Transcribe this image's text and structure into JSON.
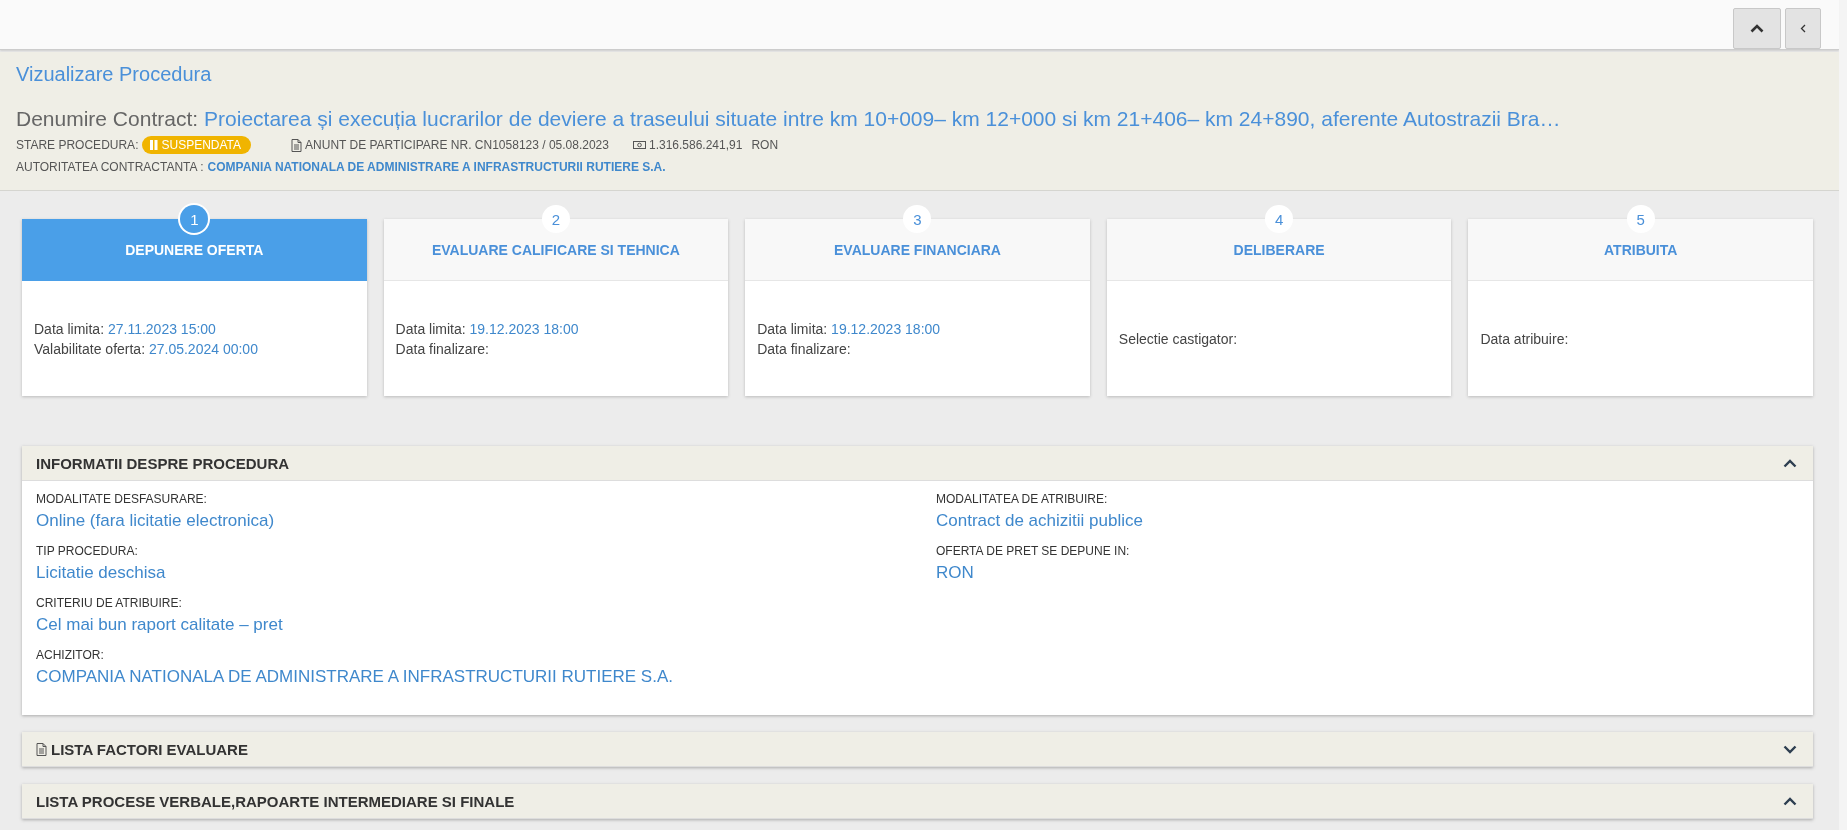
{
  "toolbar": {
    "buttons": [
      {
        "kind": "collapse"
      },
      {
        "kind": "back"
      }
    ]
  },
  "header": {
    "title": "Vizualizare Procedura",
    "contract_label": "Denumire Contract:",
    "contract_name": "Proiectarea și execuția lucrarilor de deviere a traseului situate intre km 10+009– km 12+000 si km 21+406– km 24+890, aferente Autostrazii Bra…",
    "status_label": "STARE PROCEDURA:",
    "status": "SUSPENDATA",
    "notice": "ANUNT DE PARTICIPARE NR. CN1058123 / 05.08.2023",
    "value": "1.316.586.241,91",
    "currency": "RON",
    "authority_label": "AUTORITATEA CONTRACTANTA :",
    "authority": "COMPANIA NATIONALA DE ADMINISTRARE A INFRASTRUCTURII RUTIERE S.A."
  },
  "steps": [
    {
      "number": "1",
      "title": "DEPUNERE OFERTA",
      "selected": true,
      "fields": [
        {
          "label": "Data limita:",
          "value": "27.11.2023 15:00"
        },
        {
          "label": "Valabilitate oferta:",
          "value": "27.05.2024 00:00"
        }
      ]
    },
    {
      "number": "2",
      "title": "EVALUARE CALIFICARE SI TEHNICA",
      "selected": false,
      "fields": [
        {
          "label": "Data limita:",
          "value": "19.12.2023 18:00"
        },
        {
          "label": "Data finalizare:"
        }
      ]
    },
    {
      "number": "3",
      "title": "EVALUARE FINANCIARA",
      "selected": false,
      "fields": [
        {
          "label": "Data limita:",
          "value": "19.12.2023 18:00"
        },
        {
          "label": "Data finalizare:"
        }
      ]
    },
    {
      "number": "4",
      "title": "DELIBERARE",
      "selected": false,
      "fields": [
        {
          "label": "Selectie castigator:"
        }
      ]
    },
    {
      "number": "5",
      "title": "ATRIBUITA",
      "selected": false,
      "fields": [
        {
          "label": "Data atribuire:"
        }
      ]
    }
  ],
  "panels": [
    {
      "title": "INFORMATII DESPRE PROCEDURA",
      "icon": false,
      "expanded": true,
      "columns": [
        [
          {
            "label": "MODALITATE DESFASURARE:",
            "value": "Online (fara licitatie electronica)"
          },
          {
            "label": "TIP PROCEDURA:",
            "value": "Licitatie deschisa"
          },
          {
            "label": "CRITERIU DE ATRIBUIRE:",
            "value": "Cel mai bun raport calitate – pret"
          },
          {
            "label": "ACHIZITOR:",
            "value": "COMPANIA NATIONALA DE ADMINISTRARE A INFRASTRUCTURII RUTIERE S.A."
          }
        ],
        [
          {
            "label": "MODALITATEA DE ATRIBUIRE:",
            "value": "Contract de achizitii publice"
          },
          {
            "label": "OFERTA DE PRET SE DEPUNE IN:",
            "value": "RON"
          }
        ]
      ]
    },
    {
      "title": "LISTA FACTORI EVALUARE",
      "icon": true,
      "expanded": false
    },
    {
      "title": "LISTA PROCESE VERBALE,RAPOARTE INTERMEDIARE SI FINALE",
      "icon": false,
      "expanded": true
    }
  ]
}
